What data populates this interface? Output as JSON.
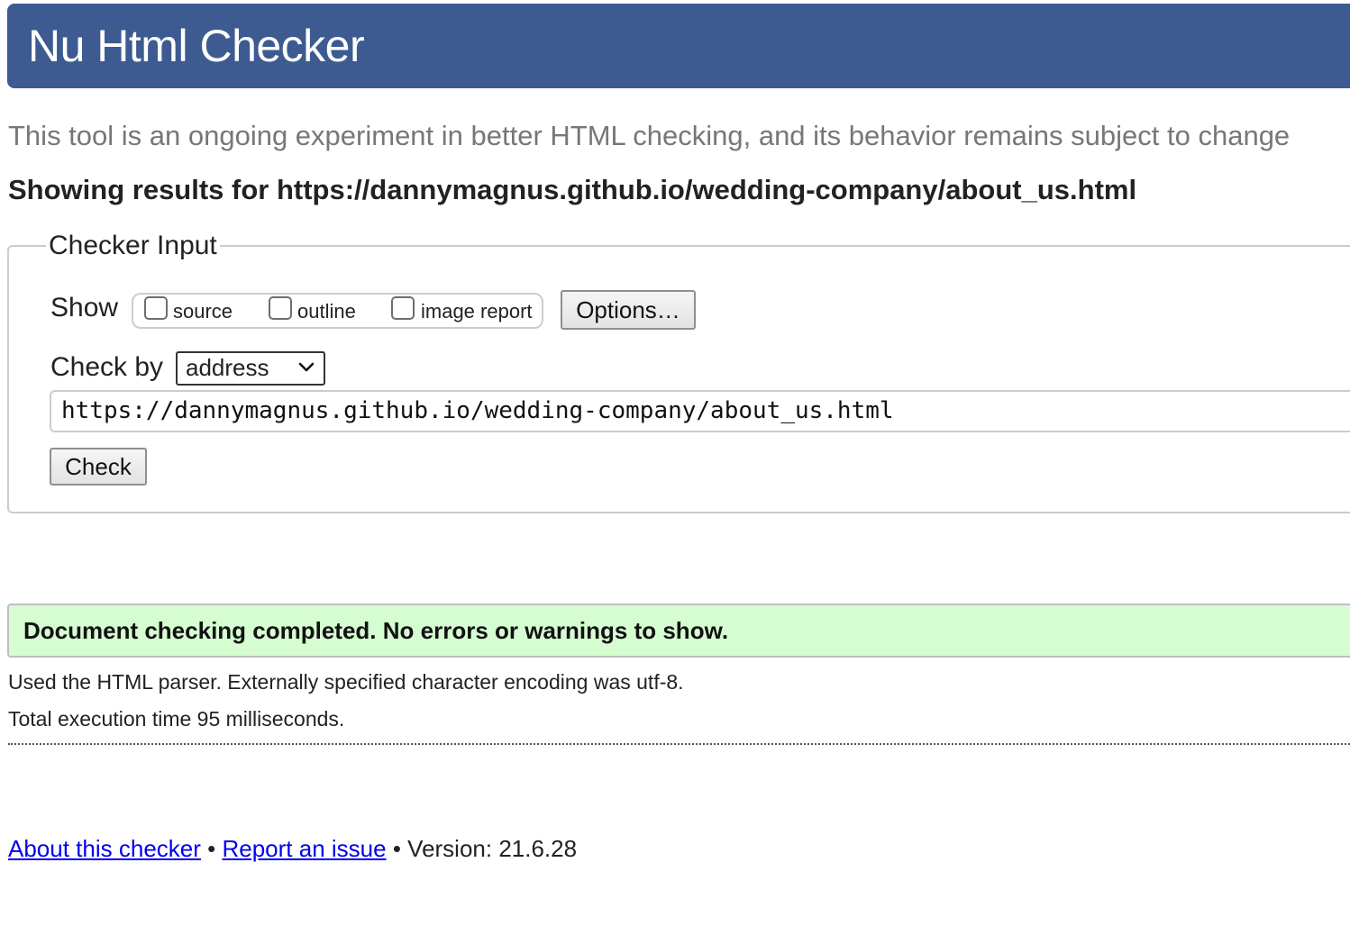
{
  "header": {
    "title": "Nu Html Checker"
  },
  "tagline": "This tool is an ongoing experiment in better HTML checking, and its behavior remains subject to change",
  "results_heading": "Showing results for https://dannymagnus.github.io/wedding-company/about_us.html",
  "checker_input": {
    "legend": "Checker Input",
    "show_label": "Show",
    "show_options": [
      {
        "label": "source",
        "checked": false
      },
      {
        "label": "outline",
        "checked": false
      },
      {
        "label": "image report",
        "checked": false
      }
    ],
    "options_button": "Options…",
    "check_by_label": "Check by",
    "check_by_value": "address",
    "url_value": "https://dannymagnus.github.io/wedding-company/about_us.html",
    "check_button": "Check"
  },
  "result": {
    "success_message": "Document checking completed. No errors or warnings to show.",
    "success_color": "#d5fdd1",
    "parser_info": "Used the HTML parser. Externally specified character encoding was utf-8.",
    "execution_time": "Total execution time 95 milliseconds."
  },
  "footer": {
    "about_link": "About this checker",
    "separator": "•",
    "report_link": "Report an issue",
    "version": "Version: 21.6.28"
  },
  "colors": {
    "header_bg": "#3d5b91",
    "link": "#0000ee"
  }
}
